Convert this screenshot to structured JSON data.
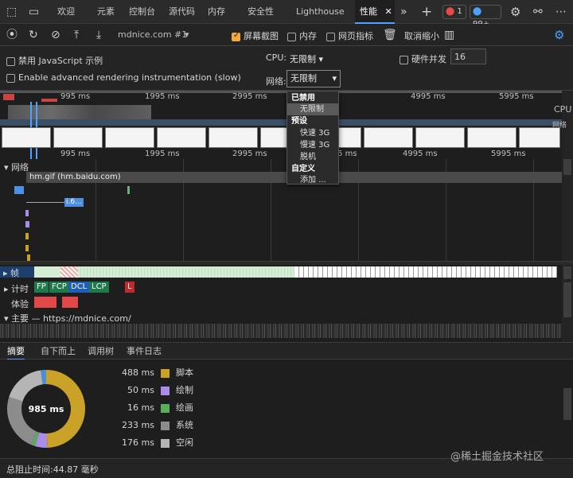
{
  "tabs": [
    "欢迎",
    "元素",
    "控制台",
    "源代码",
    "内存",
    "安全性",
    "Lighthouse",
    "性能"
  ],
  "active_tab_close": "✕",
  "badges": {
    "errors": "1",
    "messages": "99+"
  },
  "toolbar": {
    "url": "mdnice.com #1",
    "screenshots": "屏幕截图",
    "memory": "内存",
    "web_vitals": "网页指标",
    "cancel_zoom": "取消缩小",
    "screenshots_checked": true
  },
  "settings": {
    "disable_js": "禁用 JavaScript 示例",
    "advanced_rendering": "Enable advanced rendering instrumentation (slow)",
    "cpu_label": "CPU:",
    "cpu_value": "无限制",
    "hw_concurrency": "硬件并发",
    "hw_value": "16",
    "network_label": "网络:",
    "network_value": "无限制"
  },
  "network_dropdown": {
    "disabled_header": "已禁用",
    "no_throttle": "无限制",
    "presets_header": "预设",
    "fast3g": "快速 3G",
    "slow3g": "慢速 3G",
    "offline": "脱机",
    "custom_header": "自定义",
    "add": "添加 ..."
  },
  "overview": {
    "ticks": [
      "995 ms",
      "1995 ms",
      "2995 ms",
      "4995 ms",
      "5995 ms"
    ],
    "ticks2": [
      "995 ms",
      "1995 ms",
      "2995 ms",
      "3995 ms",
      "4995 ms",
      "5995 ms"
    ],
    "cpu_label": "CPU",
    "net_label": "网络"
  },
  "network_track": {
    "title": "网络",
    "request": "hm.gif (hm.baidu.com)",
    "small_label": "i.6..."
  },
  "tracks": {
    "frames": "帧",
    "timings": "计时",
    "experience": "体验",
    "main": "主要 — https://mdnice.com/",
    "fp": "FP",
    "fcp": "FCP",
    "dcl": "DCL",
    "lcp": "LCP",
    "l": "L"
  },
  "bottom_tabs": [
    "摘要",
    "自下而上",
    "调用树",
    "事件日志"
  ],
  "summary": {
    "total": "985 ms",
    "items": [
      {
        "value": "488 ms",
        "label": "脚本",
        "color": "#c9a227"
      },
      {
        "value": "50 ms",
        "label": "绘制",
        "color": "#a98de8"
      },
      {
        "value": "16 ms",
        "label": "绘画",
        "color": "#5aae5a"
      },
      {
        "value": "233 ms",
        "label": "系统",
        "color": "#8c8c8c"
      },
      {
        "value": "176 ms",
        "label": "空闲",
        "color": "#b5b5b5"
      }
    ],
    "pie": [
      {
        "ms": 488,
        "color": "#c9a227"
      },
      {
        "ms": 50,
        "color": "#a98de8"
      },
      {
        "ms": 16,
        "color": "#5aae5a"
      },
      {
        "ms": 233,
        "color": "#8c8c8c"
      },
      {
        "ms": 176,
        "color": "#b5b5b5"
      },
      {
        "ms": 22,
        "color": "#4a8fd8"
      }
    ]
  },
  "footer": {
    "blocking": "总阻止时间:44.87 毫秒",
    "watermark": "@稀土掘金技术社区"
  }
}
